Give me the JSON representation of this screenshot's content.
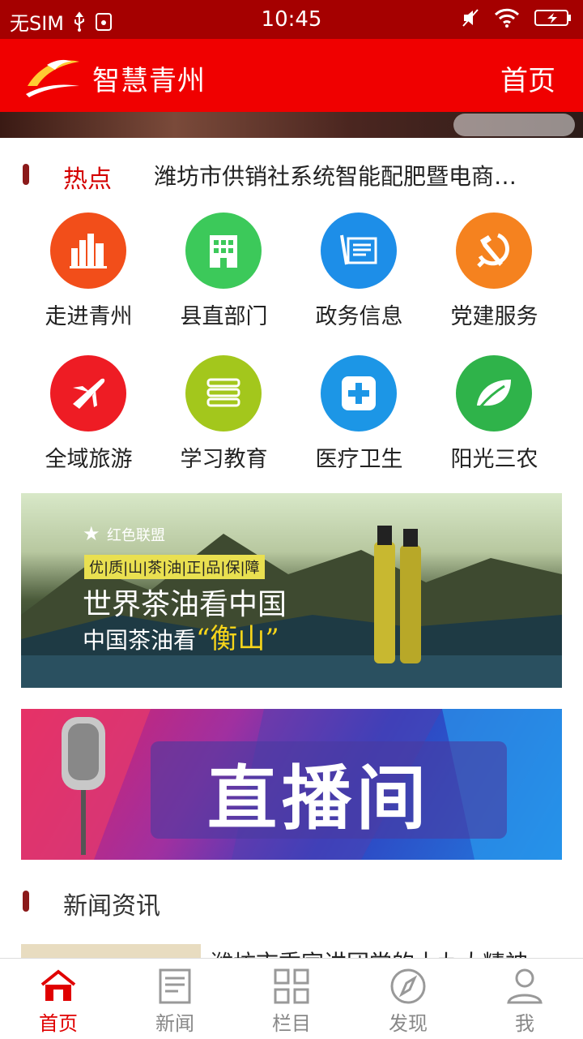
{
  "status": {
    "carrier": "无SIM",
    "time": "10:45"
  },
  "header": {
    "title": "智慧青州",
    "home": "首页"
  },
  "hot": {
    "label": "热点",
    "text": "潍坊市供销社系统智能配肥暨电商…"
  },
  "grid": [
    {
      "label": "走进青州",
      "color": "#f24e1a",
      "icon": "city-icon"
    },
    {
      "label": "县直部门",
      "color": "#3cc95a",
      "icon": "building-icon"
    },
    {
      "label": "政务信息",
      "color": "#1d8ee8",
      "icon": "document-icon"
    },
    {
      "label": "党建服务",
      "color": "#f5821f",
      "icon": "hammer-sickle-icon"
    },
    {
      "label": "全域旅游",
      "color": "#ee1c24",
      "icon": "airplane-icon"
    },
    {
      "label": "学习教育",
      "color": "#a3c71c",
      "icon": "books-icon"
    },
    {
      "label": "医疗卫生",
      "color": "#1c96e6",
      "icon": "medical-cross-icon"
    },
    {
      "label": "阳光三农",
      "color": "#2fb34a",
      "icon": "leaf-icon"
    }
  ],
  "ad1": {
    "brand": "红色联盟",
    "tag": "优|质|山|茶|油|正|品|保|障",
    "line1": "世界茶油看中国",
    "line2a": "中国茶油看",
    "line2b": "“衡山”"
  },
  "ad2": {
    "title": "直播间"
  },
  "news": {
    "label": "新闻资讯",
    "first_title": "潍坊市委宣讲团党的十九大精神"
  },
  "tabs": [
    {
      "label": "首页",
      "icon": "home-icon",
      "active": true
    },
    {
      "label": "新闻",
      "icon": "news-icon",
      "active": false
    },
    {
      "label": "栏目",
      "icon": "columns-icon",
      "active": false
    },
    {
      "label": "发现",
      "icon": "compass-icon",
      "active": false
    },
    {
      "label": "我",
      "icon": "profile-icon",
      "active": false
    }
  ],
  "colors": {
    "header": "#f00000",
    "statusbar": "#a50000",
    "accent": "#e00000"
  }
}
